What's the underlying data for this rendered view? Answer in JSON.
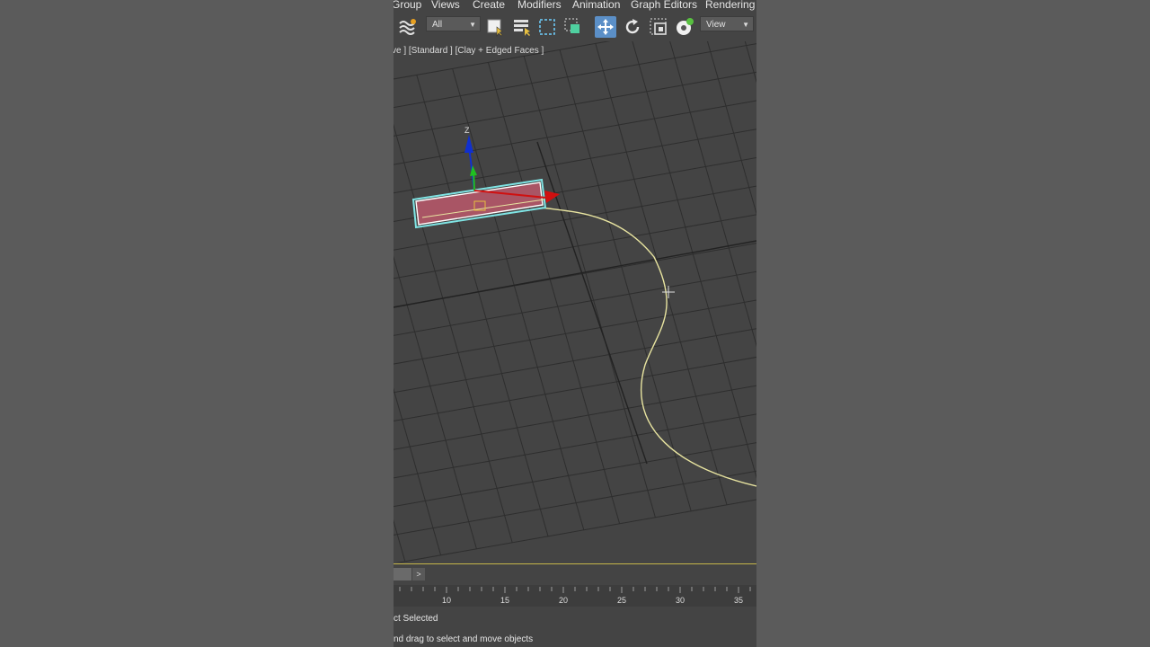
{
  "menu": [
    "Group",
    "Views",
    "Create",
    "Modifiers",
    "Animation",
    "Graph Editors",
    "Rendering"
  ],
  "toolbar": {
    "selection_filter": "All",
    "reference_coord": "View"
  },
  "viewport": {
    "label": "ve ] [Standard ] [Clay + Edged Faces ]",
    "gizmo_axis_label": "Z"
  },
  "time_slider": {
    "next_label": ">"
  },
  "trackbar": {
    "ticks": [
      "10",
      "15",
      "20",
      "25",
      "30",
      "35"
    ]
  },
  "status": {
    "selection": "ct Selected",
    "prompt": "nd drag to select and move objects"
  },
  "colors": {
    "spline": "#e8e4a0",
    "selection_box": "#7fe4e4",
    "box_fill": "#b05a68",
    "axis_x": "#d01010",
    "axis_y": "#20c020",
    "axis_z": "#1030d0"
  }
}
